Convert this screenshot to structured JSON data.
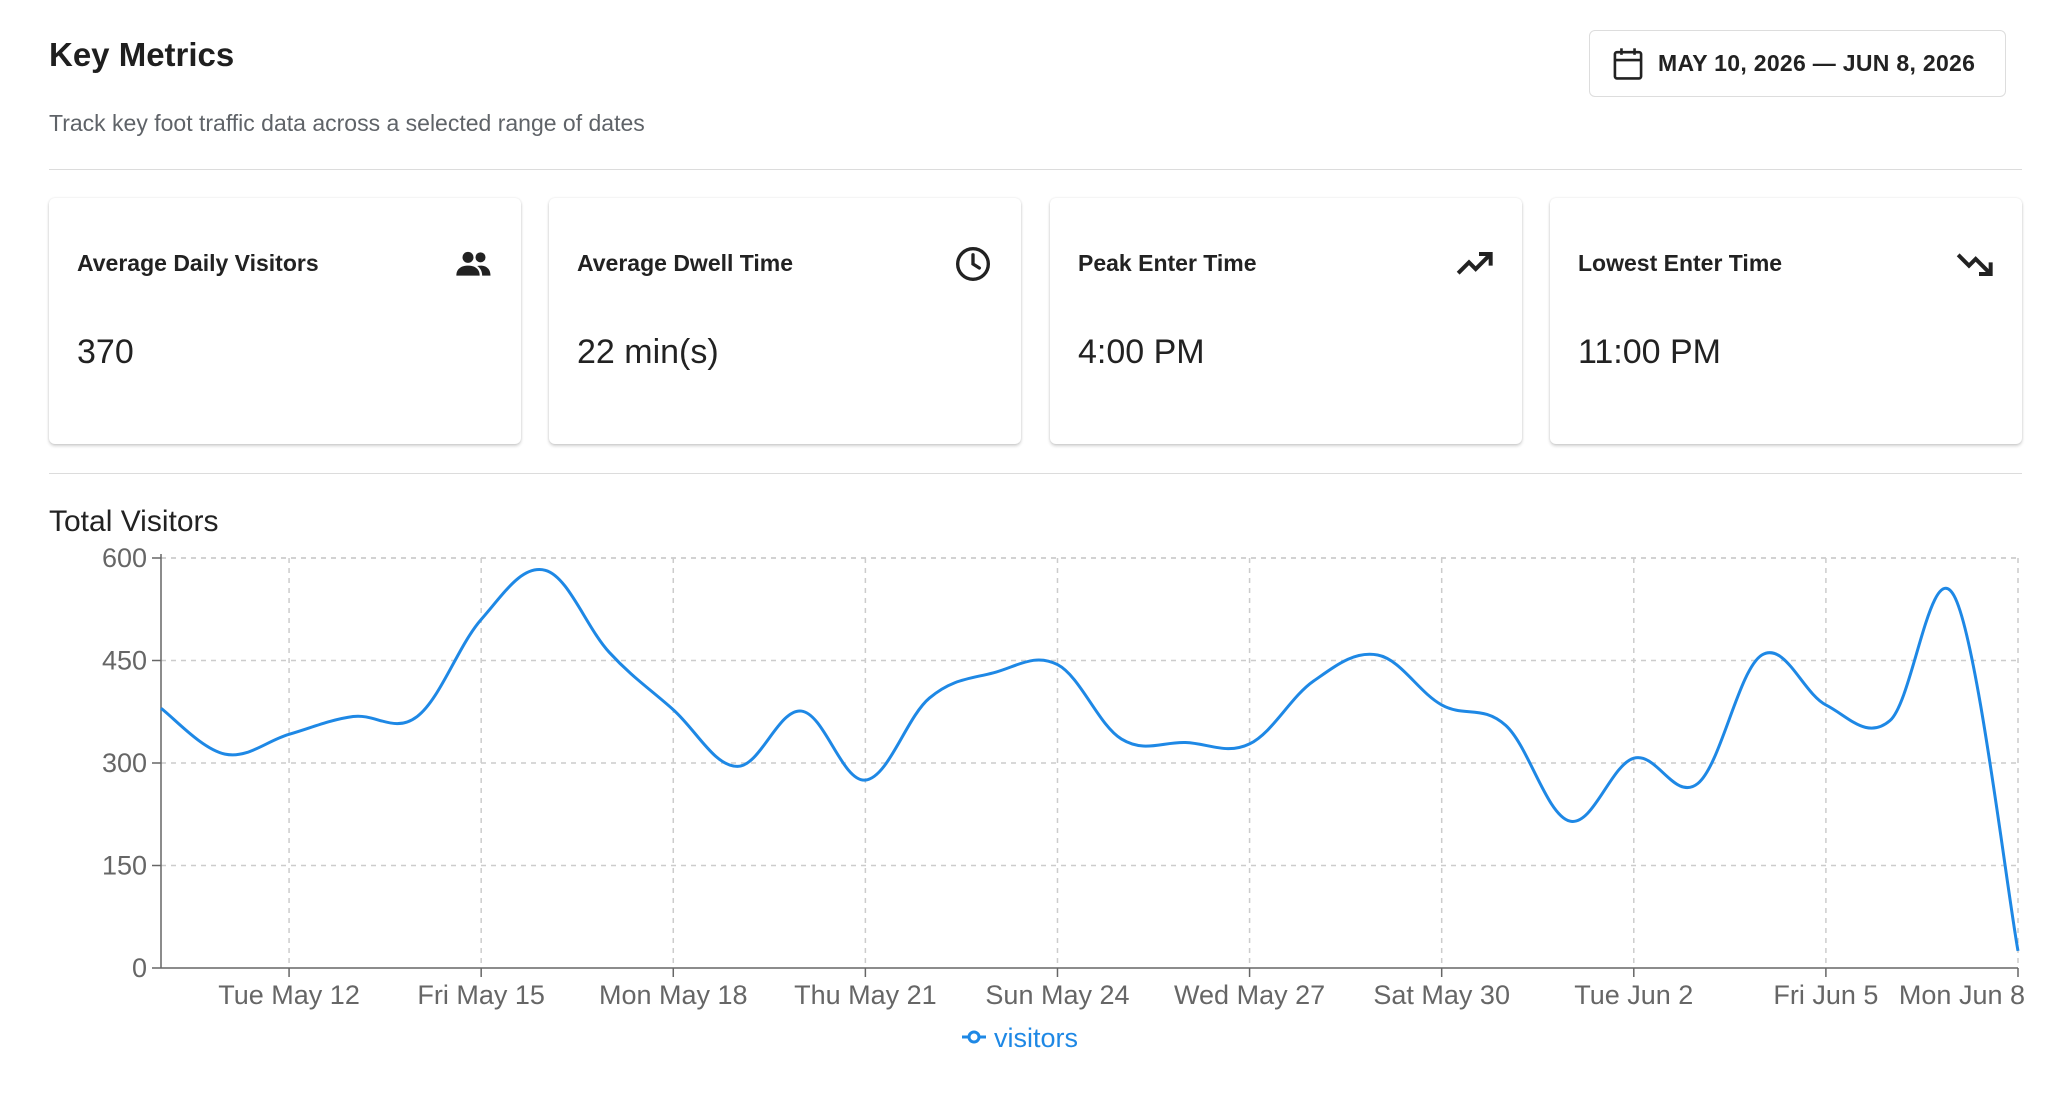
{
  "header": {
    "title": "Key Metrics",
    "subtitle": "Track key foot traffic data across a selected range of dates",
    "date_range": "MAY 10, 2026 — JUN 8, 2026",
    "date_icon": "calendar-icon"
  },
  "cards": [
    {
      "label": "Average Daily Visitors",
      "value": "370",
      "icon": "people-icon"
    },
    {
      "label": "Average Dwell Time",
      "value": "22 min(s)",
      "icon": "clock-icon"
    },
    {
      "label": "Peak Enter Time",
      "value": "4:00 PM",
      "icon": "trending-up-icon"
    },
    {
      "label": "Lowest Enter Time",
      "value": "11:00 PM",
      "icon": "trending-down-icon"
    }
  ],
  "chart_section": {
    "title": "Total Visitors"
  },
  "colors": {
    "line": "#1e88e5",
    "grid": "#cccccc",
    "axis": "#666666"
  },
  "chart_data": {
    "type": "line",
    "x_tick_labels": [
      "Tue May 12",
      "Fri May 15",
      "Mon May 18",
      "Thu May 21",
      "Sun May 24",
      "Wed May 27",
      "Sat May 30",
      "Tue Jun 2",
      "Fri Jun 5",
      "Mon Jun 8"
    ],
    "x": [
      "2026-05-10",
      "2026-05-11",
      "2026-05-12",
      "2026-05-13",
      "2026-05-14",
      "2026-05-15",
      "2026-05-16",
      "2026-05-17",
      "2026-05-18",
      "2026-05-19",
      "2026-05-20",
      "2026-05-21",
      "2026-05-22",
      "2026-05-23",
      "2026-05-24",
      "2026-05-25",
      "2026-05-26",
      "2026-05-27",
      "2026-05-28",
      "2026-05-29",
      "2026-05-30",
      "2026-05-31",
      "2026-06-01",
      "2026-06-02",
      "2026-06-03",
      "2026-06-04",
      "2026-06-05",
      "2026-06-06",
      "2026-06-07",
      "2026-06-08"
    ],
    "series": [
      {
        "name": "visitors",
        "values": [
          380,
          313,
          342,
          368,
          368,
          510,
          582,
          462,
          378,
          295,
          376,
          275,
          395,
          432,
          444,
          335,
          330,
          328,
          420,
          458,
          385,
          355,
          215,
          307,
          270,
          458,
          385,
          362,
          545,
          25
        ]
      }
    ],
    "ylim": [
      0,
      600
    ],
    "yticks": [
      0,
      150,
      300,
      450,
      600
    ],
    "grid": true,
    "legend": "bottom-center"
  }
}
